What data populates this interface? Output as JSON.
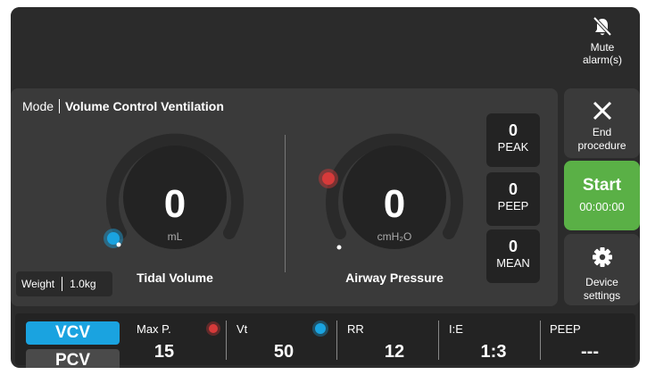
{
  "header": {
    "mute_label_line1": "Mute",
    "mute_label_line2": "alarm(s)"
  },
  "mode": {
    "label": "Mode",
    "value": "Volume Control Ventilation"
  },
  "tidal_volume": {
    "value": "0",
    "unit": "mL",
    "title": "Tidal Volume"
  },
  "airway_pressure": {
    "value": "0",
    "unit": "cmH₂O",
    "title": "Airway Pressure"
  },
  "weight": {
    "label": "Weight",
    "value": "1.0kg"
  },
  "pressure_metrics": [
    {
      "value": "0",
      "label": "PEAK"
    },
    {
      "value": "0",
      "label": "PEEP"
    },
    {
      "value": "0",
      "label": "MEAN"
    }
  ],
  "side_buttons": {
    "end_line1": "End",
    "end_line2": "procedure",
    "start_label": "Start",
    "start_timer": "00:00:00",
    "settings_line1": "Device",
    "settings_line2": "settings"
  },
  "modes": {
    "vcv": "VCV",
    "pcv": "PCV"
  },
  "params": [
    {
      "label": "Max P.",
      "value": "15"
    },
    {
      "label": "Vt",
      "value": "50"
    },
    {
      "label": "RR",
      "value": "12"
    },
    {
      "label": "I:E",
      "value": "1:3"
    },
    {
      "label": "PEEP",
      "value": "---"
    }
  ],
  "colors": {
    "accent_blue": "#1aa3e0",
    "start_green": "#5ab046",
    "alarm_red": "#d63a3a"
  }
}
